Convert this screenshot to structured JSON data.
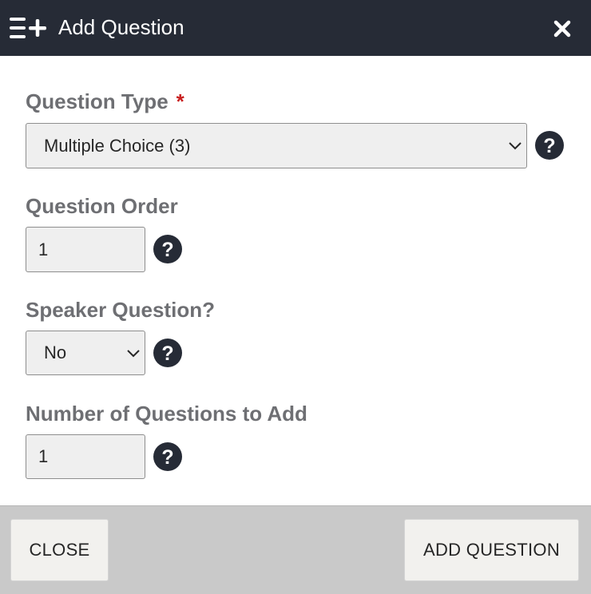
{
  "header": {
    "title": "Add Question",
    "icon": "list-add-icon",
    "close_icon": "close-icon"
  },
  "form": {
    "question_type": {
      "label": "Question Type",
      "required_marker": "*",
      "selected": "Multiple Choice (3)"
    },
    "question_order": {
      "label": "Question Order",
      "value": "1"
    },
    "speaker_question": {
      "label": "Speaker Question?",
      "selected": "No"
    },
    "num_questions": {
      "label": "Number of Questions to Add",
      "value": "1"
    }
  },
  "footer": {
    "close_label": "CLOSE",
    "add_label": "ADD QUESTION"
  },
  "colors": {
    "header_bg": "#262b36",
    "label": "#6e6f73",
    "required": "#c81e1e",
    "footer_bg": "#c9c9c9",
    "help_icon": "#262b36"
  }
}
